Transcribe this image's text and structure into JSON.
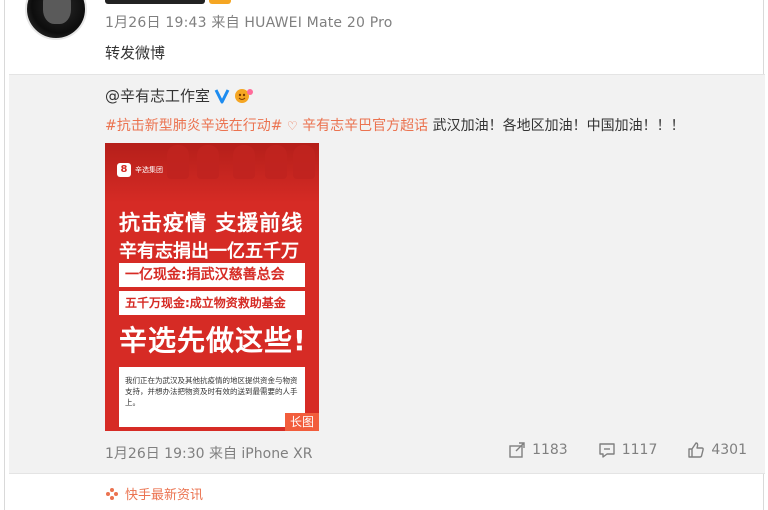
{
  "post": {
    "meta": "1月26日 19:43 来自 HUAWEI Mate 20 Pro",
    "text": "转发微博"
  },
  "original": {
    "author": "@辛有志工作室",
    "hashtag": "#抗击新型肺炎辛选在行动#",
    "supertopic": "辛有志辛巴官方超话",
    "body": " 武汉加油！各地区加油！中国加油！！！",
    "image": {
      "logo_text": "辛选集团",
      "line1": "抗击疫情  支援前线",
      "line2": "辛有志捐出一亿五千万",
      "bar1": "一亿现金:捐武汉慈善总会",
      "bar2": "五千万现金:成立物资救助基金",
      "big": "辛选先做这些!",
      "card": "我们正在为武汉及其他抗疫情的地区提供资金与物资支持，并想办法把物资及时有效的送到最需要的人手上。",
      "badge": "长图"
    },
    "meta": "1月26日 19:30 来自 iPhone XR",
    "reposts": "1183",
    "comments": "1117",
    "likes": "4301"
  },
  "source": {
    "label": "快手最新资讯"
  },
  "colors": {
    "accent": "#eb7350",
    "poster_red": "#d62b25",
    "badge": "#f25d3c",
    "verified": "#1d8cf0"
  }
}
